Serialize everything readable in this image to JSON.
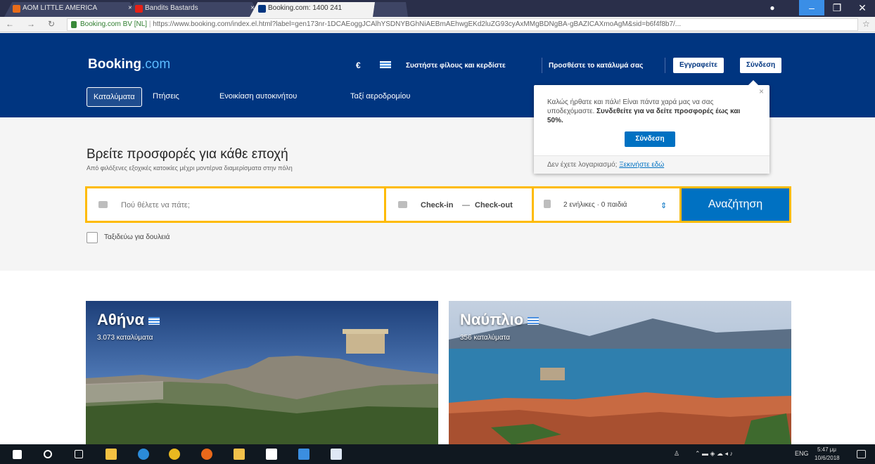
{
  "browser": {
    "tabs": [
      {
        "title": "AOM LITTLE AMERICA",
        "active": false,
        "favicon_color": "#e86c1a"
      },
      {
        "title": "Bandits Bastards",
        "active": false,
        "favicon_color": "#e62117"
      },
      {
        "title": "Booking.com: 1400 241",
        "active": true,
        "favicon_color": "#003580"
      }
    ],
    "url_host": "Booking.com BV [NL]",
    "url": "https://www.booking.com/index.el.html?label=gen173nr-1DCAEoggJCAlhYSDNYBGhNiAEBmAEhwgEKd2luZG93cyAxMMgBDNgBA-gBAZICAXmoAgM&sid=b6f4f8b7/..."
  },
  "header": {
    "logo_main": "Booking",
    "logo_dot": ".com",
    "currency": "€",
    "refer_link": "Συστήστε φίλους και κερδίστε",
    "list_property": "Προσθέστε το κατάλυμά σας",
    "register": "Εγγραφείτε",
    "signin": "Σύνδεση",
    "nav": [
      "Καταλύματα",
      "Πτήσεις",
      "Ενοικίαση αυτοκινήτου",
      "Ταξί αεροδρομίου"
    ]
  },
  "popup": {
    "text_plain": "Καλώς ήρθατε και πάλι! Είναι πάντα χαρά μας να σας υποδεχόμαστε.",
    "text_bold": "Συνδεθείτε για να δείτε προσφορές έως και 50%.",
    "button": "Σύνδεση",
    "footer_text": "Δεν έχετε λογαριασμό;",
    "footer_link": "Ξεκινήστε εδώ",
    "close": "×"
  },
  "hero": {
    "title": "Βρείτε προσφορές για κάθε εποχή",
    "subtitle": "Από φιλόξενες εξοχικές κατοικίες μέχρι μοντέρνα διαμερίσματα στην πόλη",
    "destination_placeholder": "Πού θέλετε να πάτε;",
    "checkin": "Check-in",
    "dash": "—",
    "checkout": "Check-out",
    "guests": "2 ενήλικες · 0 παιδιά",
    "search_button": "Αναζήτηση",
    "work_travel": "Ταξιδεύω για δουλειά"
  },
  "cards": [
    {
      "name": "Αθήνα",
      "count": "3.073 καταλύματα"
    },
    {
      "name": "Ναύπλιο",
      "count": "356 καταλύματα"
    }
  ],
  "taskbar": {
    "lang": "ENG",
    "time": "5:47 μμ",
    "date": "10/6/2018"
  }
}
